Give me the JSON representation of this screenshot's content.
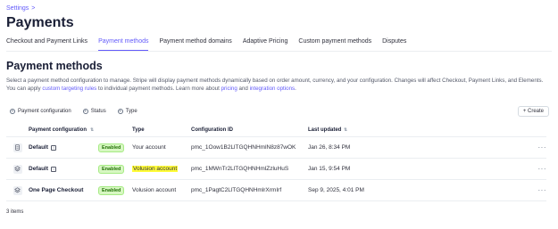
{
  "breadcrumb": {
    "label": "Settings",
    "separator": ">"
  },
  "page_title": "Payments",
  "tabs": [
    {
      "label": "Checkout and Payment Links"
    },
    {
      "label": "Payment methods"
    },
    {
      "label": "Payment method domains"
    },
    {
      "label": "Adaptive Pricing"
    },
    {
      "label": "Custom payment methods"
    },
    {
      "label": "Disputes"
    }
  ],
  "active_tab": "Payment methods",
  "section_title": "Payment methods",
  "description": {
    "part1": "Select a payment method configuration to manage. Stripe will display payment methods dynamically based on order amount, currency, and your configuration. Changes will affect Checkout, Payment Links, and Elements. You can apply ",
    "link1": "custom targeting rules",
    "part2": " to individual payment methods. Learn more about ",
    "link2": "pricing",
    "part3": " and ",
    "link3": "integration options",
    "part4": "."
  },
  "filters": [
    {
      "label": "Payment configuration"
    },
    {
      "label": "Status"
    },
    {
      "label": "Type"
    }
  ],
  "create_button": {
    "label": "+ Create"
  },
  "table": {
    "headers": {
      "name": "Payment configuration",
      "sort_glyph": "⇅",
      "type": "Type",
      "id": "Configuration ID",
      "updated": "Last updated"
    },
    "rows": [
      {
        "name": "Default",
        "status": "Enabled",
        "type": "Your account",
        "type_highlighted": false,
        "id": "pmc_1Oow1B2LlTGQHNHmlN8z87wOK",
        "updated": "Jan 26, 8:34 PM",
        "has_info": true,
        "icon": "document-icon"
      },
      {
        "name": "Default",
        "status": "Enabled",
        "type": "Volusion account",
        "type_highlighted": true,
        "id": "pmc_1MWnTr2LlTGQHNHmlZzluHuS",
        "updated": "Jan 15, 9:54 PM",
        "has_info": true,
        "icon": "layers-icon"
      },
      {
        "name": "One Page Checkout",
        "status": "Enabled",
        "type": "Volusion account",
        "type_highlighted": false,
        "id": "pmc_1PagtC2LlTGQHNHmlrXrmIrf",
        "updated": "Sep 9, 2025, 4:01 PM",
        "has_info": false,
        "icon": "layers-icon"
      }
    ],
    "more_glyph": "···"
  },
  "items_count": "3 items",
  "colors": {
    "accent": "#625afa",
    "badge_bg": "#d7f7c2",
    "badge_text": "#217005",
    "highlight": "#fffb39"
  }
}
